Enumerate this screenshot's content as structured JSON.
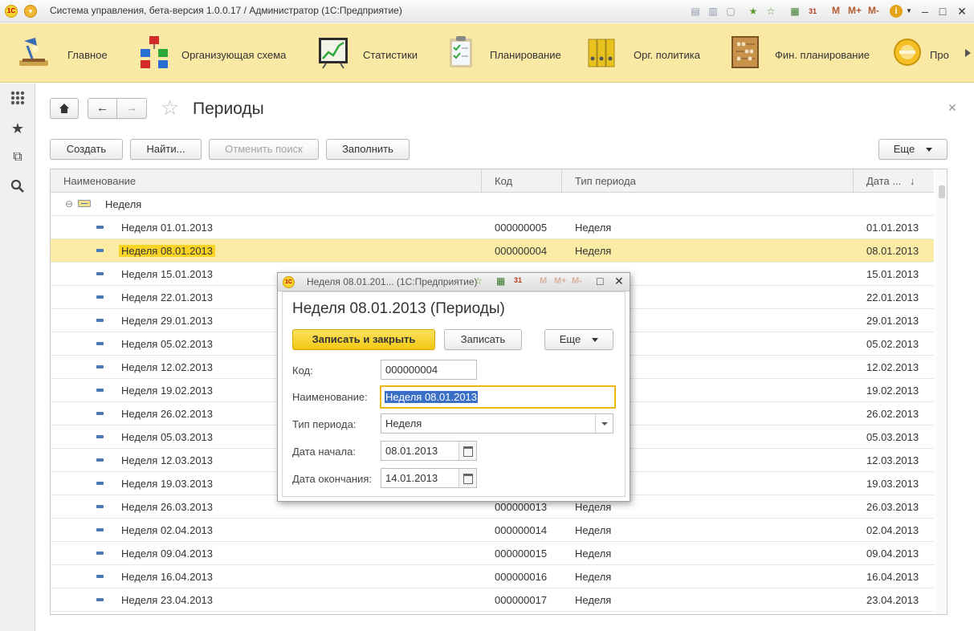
{
  "window": {
    "title": "Система управления, бета-версия 1.0.0.17 / Администратор  (1С:Предприятие)",
    "logo_text": "1С",
    "toolbar_m": [
      "M",
      "M+",
      "M-"
    ]
  },
  "sections": [
    {
      "label": "Главное",
      "icon": "desk-lamp-icon"
    },
    {
      "label": "Организующая схема",
      "icon": "org-chart-icon"
    },
    {
      "label": "Статистики",
      "icon": "chart-board-icon"
    },
    {
      "label": "Планирование",
      "icon": "clipboard-icon"
    },
    {
      "label": "Орг. политика",
      "icon": "binders-icon"
    },
    {
      "label": "Фин. планирование",
      "icon": "abacus-icon"
    },
    {
      "label": "Про",
      "icon": "disc-icon"
    }
  ],
  "sidebar": [
    "apps-grid-icon",
    "favorites-star-icon",
    "history-icon",
    "search-icon"
  ],
  "page": {
    "title": "Периоды",
    "buttons": {
      "create": "Создать",
      "find": "Найти...",
      "cancel_search": "Отменить поиск",
      "fill": "Заполнить",
      "more": "Еще"
    }
  },
  "table": {
    "columns": [
      "Наименование",
      "Код",
      "Тип периода",
      "Дата ..."
    ],
    "group": {
      "label": "Неделя",
      "toggle": "⊖"
    },
    "rows": [
      {
        "name": "Неделя 01.01.2013",
        "code": "000000005",
        "type": "Неделя",
        "date": "01.01.2013"
      },
      {
        "name": "Неделя 08.01.2013",
        "code": "000000004",
        "type": "Неделя",
        "date": "08.01.2013",
        "selected": true
      },
      {
        "name": "Неделя 15.01.2013",
        "code": "",
        "type": "",
        "date": "15.01.2013"
      },
      {
        "name": "Неделя 22.01.2013",
        "code": "",
        "type": "",
        "date": "22.01.2013"
      },
      {
        "name": "Неделя 29.01.2013",
        "code": "",
        "type": "",
        "date": "29.01.2013"
      },
      {
        "name": "Неделя 05.02.2013",
        "code": "",
        "type": "",
        "date": "05.02.2013"
      },
      {
        "name": "Неделя 12.02.2013",
        "code": "",
        "type": "",
        "date": "12.02.2013"
      },
      {
        "name": "Неделя 19.02.2013",
        "code": "",
        "type": "",
        "date": "19.02.2013"
      },
      {
        "name": "Неделя 26.02.2013",
        "code": "",
        "type": "",
        "date": "26.02.2013"
      },
      {
        "name": "Неделя 05.03.2013",
        "code": "",
        "type": "",
        "date": "05.03.2013"
      },
      {
        "name": "Неделя 12.03.2013",
        "code": "",
        "type": "",
        "date": "12.03.2013"
      },
      {
        "name": "Неделя 19.03.2013",
        "code": "",
        "type": "",
        "date": "19.03.2013"
      },
      {
        "name": "Неделя 26.03.2013",
        "code": "000000013",
        "type": "Неделя",
        "date": "26.03.2013"
      },
      {
        "name": "Неделя 02.04.2013",
        "code": "000000014",
        "type": "Неделя",
        "date": "02.04.2013"
      },
      {
        "name": "Неделя 09.04.2013",
        "code": "000000015",
        "type": "Неделя",
        "date": "09.04.2013"
      },
      {
        "name": "Неделя 16.04.2013",
        "code": "000000016",
        "type": "Неделя",
        "date": "16.04.2013"
      },
      {
        "name": "Неделя 23.04.2013",
        "code": "000000017",
        "type": "Неделя",
        "date": "23.04.2013"
      }
    ]
  },
  "dialog": {
    "window_title": "Неделя 08.01.201...  (1С:Предприятие)",
    "heading": "Неделя 08.01.2013 (Периоды)",
    "buttons": {
      "save_close": "Записать и закрыть",
      "save": "Записать",
      "more": "Еще"
    },
    "fields": {
      "code": {
        "label": "Код:",
        "value": "000000004"
      },
      "name": {
        "label": "Наименование:",
        "value": "Неделя 08.01.2013"
      },
      "type": {
        "label": "Тип периода:",
        "value": "Неделя"
      },
      "start": {
        "label": "Дата начала:",
        "value": "08.01.2013"
      },
      "end": {
        "label": "Дата окончания:",
        "value": "14.01.2013"
      }
    },
    "toolbar_m": [
      "M",
      "M+",
      "M-"
    ]
  },
  "colors": {
    "sections_bg": "#fae9a5",
    "selected_row": "#fbeca5",
    "primary_button": "#f7cf21",
    "focus_border": "#e8b810"
  }
}
